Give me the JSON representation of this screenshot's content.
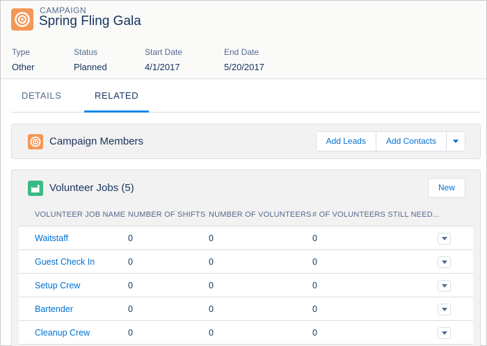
{
  "header": {
    "object_label": "CAMPAIGN",
    "title": "Spring Fling Gala",
    "icon": "campaign-target-icon",
    "fields": [
      {
        "label": "Type",
        "value": "Other"
      },
      {
        "label": "Status",
        "value": "Planned"
      },
      {
        "label": "Start Date",
        "value": "4/1/2017"
      },
      {
        "label": "End Date",
        "value": "5/20/2017"
      }
    ]
  },
  "tabs": [
    {
      "label": "DETAILS",
      "active": false
    },
    {
      "label": "RELATED",
      "active": true
    }
  ],
  "campaign_members": {
    "title": "Campaign Members",
    "icon": "campaign-members-icon",
    "add_leads": "Add Leads",
    "add_contacts": "Add Contacts",
    "more_icon": "chevron-down-icon"
  },
  "volunteer_jobs": {
    "title": "Volunteer Jobs (5)",
    "icon": "volunteer-jobs-icon",
    "new_label": "New",
    "columns": [
      "VOLUNTEER JOB NAME",
      "NUMBER OF SHIFTS",
      "NUMBER OF VOLUNTEERS",
      "# OF VOLUNTEERS STILL NEED..."
    ],
    "rows": [
      {
        "name": "Waitstaff",
        "shifts": "0",
        "volunteers": "0",
        "still_needed": "0"
      },
      {
        "name": "Guest Check In",
        "shifts": "0",
        "volunteers": "0",
        "still_needed": "0"
      },
      {
        "name": "Setup Crew",
        "shifts": "0",
        "volunteers": "0",
        "still_needed": "0"
      },
      {
        "name": "Bartender",
        "shifts": "0",
        "volunteers": "0",
        "still_needed": "0"
      },
      {
        "name": "Cleanup Crew",
        "shifts": "0",
        "volunteers": "0",
        "still_needed": "0"
      }
    ]
  },
  "colors": {
    "campaign_orange": "#f49756",
    "volunteer_green": "#3bba85",
    "link_blue": "#0070d2",
    "tab_indicator": "#1589ee"
  }
}
